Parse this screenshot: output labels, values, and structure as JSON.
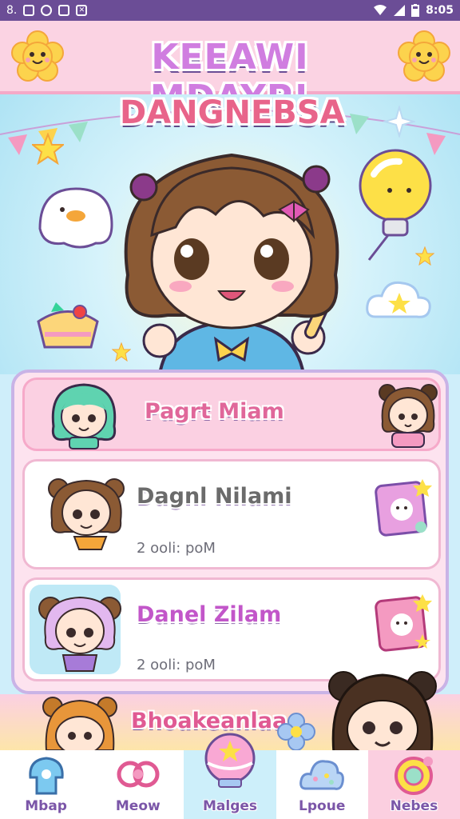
{
  "status_bar": {
    "left_text": "8.",
    "time": "8:05"
  },
  "header": {
    "title_line1": "KEEAWI MDAYP!",
    "title_line2": "DANGNEBSA"
  },
  "list": [
    {
      "name": "Pagrt Miam",
      "time": "",
      "name_color": "#e0679a"
    },
    {
      "name": "Dagnl Nilami",
      "time": "2 ooli: poM",
      "name_color": "#6b6b6b"
    },
    {
      "name": "Danel Zilam",
      "time": "2 ooli: poM",
      "name_color": "#c256c9"
    }
  ],
  "bottom_banner": "Bhoakeanlaa",
  "nav": [
    {
      "label": "Mbap",
      "icon": "home-icon",
      "bg": "#ffffff"
    },
    {
      "label": "Meow",
      "icon": "bow-icon",
      "bg": "#ffffff"
    },
    {
      "label": "Malges",
      "icon": "orb-icon",
      "bg": "#cdeffa"
    },
    {
      "label": "Lpoue",
      "icon": "cloud-icon",
      "bg": "#ffffff"
    },
    {
      "label": "Nebes",
      "icon": "swirl-icon",
      "bg": "#fbcfe0"
    }
  ],
  "colors": {
    "status_bar": "#6b4d96",
    "header_bg": "#fbd3e3",
    "panel_border": "#c9b3e6",
    "accent_pink": "#e05a93"
  }
}
